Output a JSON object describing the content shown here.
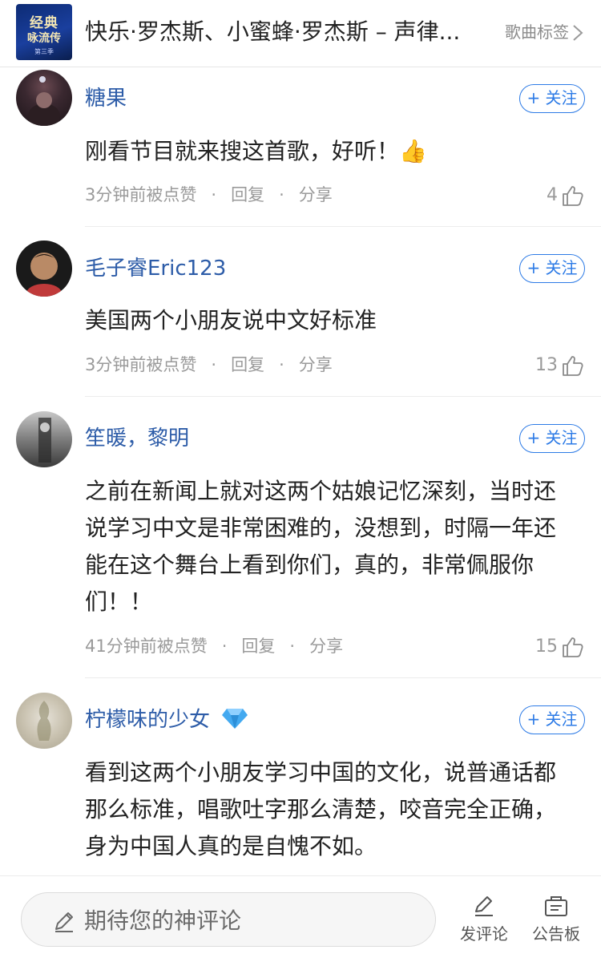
{
  "header": {
    "thumb_title_line1": "经典",
    "thumb_title_line2": "咏流传",
    "thumb_caption": "第三季",
    "song_title": "快乐·罗杰斯、小蜜蜂·罗杰斯 – 声律...",
    "tag_label": "歌曲标签"
  },
  "comments": [
    {
      "name": "糖果",
      "follow_label": "+ 关注",
      "text": "刚看节目就来搜这首歌，好听！👍",
      "time": "3分钟前被点赞",
      "reply_label": "回复",
      "share_label": "分享",
      "likes": "4",
      "sep": "·"
    },
    {
      "name": "毛子睿Eric123",
      "follow_label": "+ 关注",
      "text": "美国两个小朋友说中文好标准",
      "time": "3分钟前被点赞",
      "reply_label": "回复",
      "share_label": "分享",
      "likes": "13",
      "sep": "·"
    },
    {
      "name": "笙暖，黎明",
      "follow_label": "+ 关注",
      "text": "之前在新闻上就对这两个姑娘记忆深刻，当时还说学习中文是非常困难的，没想到，时隔一年还能在这个舞台上看到你们，真的，非常佩服你们！！",
      "time": "41分钟前被点赞",
      "reply_label": "回复",
      "share_label": "分享",
      "likes": "15",
      "sep": "·"
    },
    {
      "name": "柠檬味的少女",
      "follow_label": "+ 关注",
      "text": "看到这两个小朋友学习中国的文化，说普通话都那么标准，唱歌吐字那么清楚，咬音完全正确，身为中国人真的是自愧不如。",
      "badge_icon": "diamond-icon"
    }
  ],
  "bottom_bar": {
    "input_placeholder": "期待您的神评论",
    "post_comment_label": "发评论",
    "notice_board_label": "公告板"
  },
  "colors": {
    "username": "#2d5ca8",
    "follow": "#2d7be6",
    "meta": "#9a9a9a",
    "diamond": "#43a9f0"
  }
}
